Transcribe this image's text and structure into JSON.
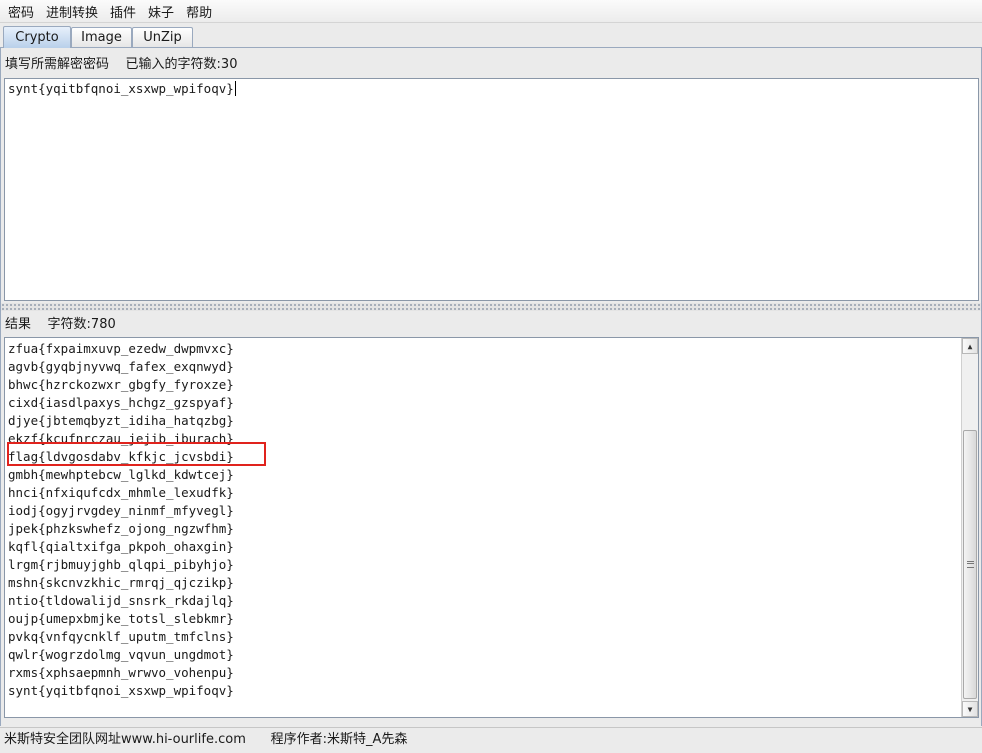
{
  "menu": [
    "密码",
    "进制转换",
    "插件",
    "妹子",
    "帮助"
  ],
  "tabs": [
    "Crypto",
    "Image",
    "UnZip"
  ],
  "input_section": {
    "label": "填写所需解密密码",
    "count_label": "已输入的字符数:30",
    "value": "synt{yqitbfqnoi_xsxwp_wpifoqv}"
  },
  "result_section": {
    "label": "结果",
    "count_label": "字符数:780",
    "lines": [
      "zfua{fxpaimxuvp_ezedw_dwpmvxc}",
      "agvb{gyqbjnyvwq_fafex_exqnwyd}",
      "bhwc{hzrckozwxr_gbgfy_fyroxze}",
      "cixd{iasdlpaxys_hchgz_gzspyaf}",
      "djye{jbtemqbyzt_idiha_hatqzbg}",
      "ekzf{kcufnrczau_jejib_iburach}",
      "flag{ldvgosdabv_kfkjc_jcvsbdi}",
      "gmbh{mewhptebcw_lglkd_kdwtcej}",
      "hnci{nfxiqufcdx_mhmle_lexudfk}",
      "iodj{ogyjrvgdey_ninmf_mfyvegl}",
      "jpek{phzkswhefz_ojong_ngzwfhm}",
      "kqfl{qialtxifga_pkpoh_ohaxgin}",
      "lrgm{rjbmuyjghb_qlqpi_pibyhjo}",
      "mshn{skcnvzkhic_rmrqj_qjczikp}",
      "ntio{tldowalijd_snsrk_rkdajlq}",
      "oujp{umepxbmjke_totsl_slebkmr}",
      "pvkq{vnfqycnklf_uputm_tmfclns}",
      "qwlr{wogrzdolmg_vqvun_ungdmot}",
      "rxms{xphsaepmnh_wrwvo_vohenpu}",
      "synt{yqitbfqnoi_xsxwp_wpifoqv}"
    ],
    "highlight_color": "#e0231d"
  },
  "status": {
    "team": "米斯特安全团队网址www.hi-ourlife.com",
    "author": "程序作者:米斯特_A先森"
  },
  "icons": [
    "scroll-up-arrow-icon",
    "scroll-down-arrow-icon",
    "scroll-grip-icon"
  ]
}
